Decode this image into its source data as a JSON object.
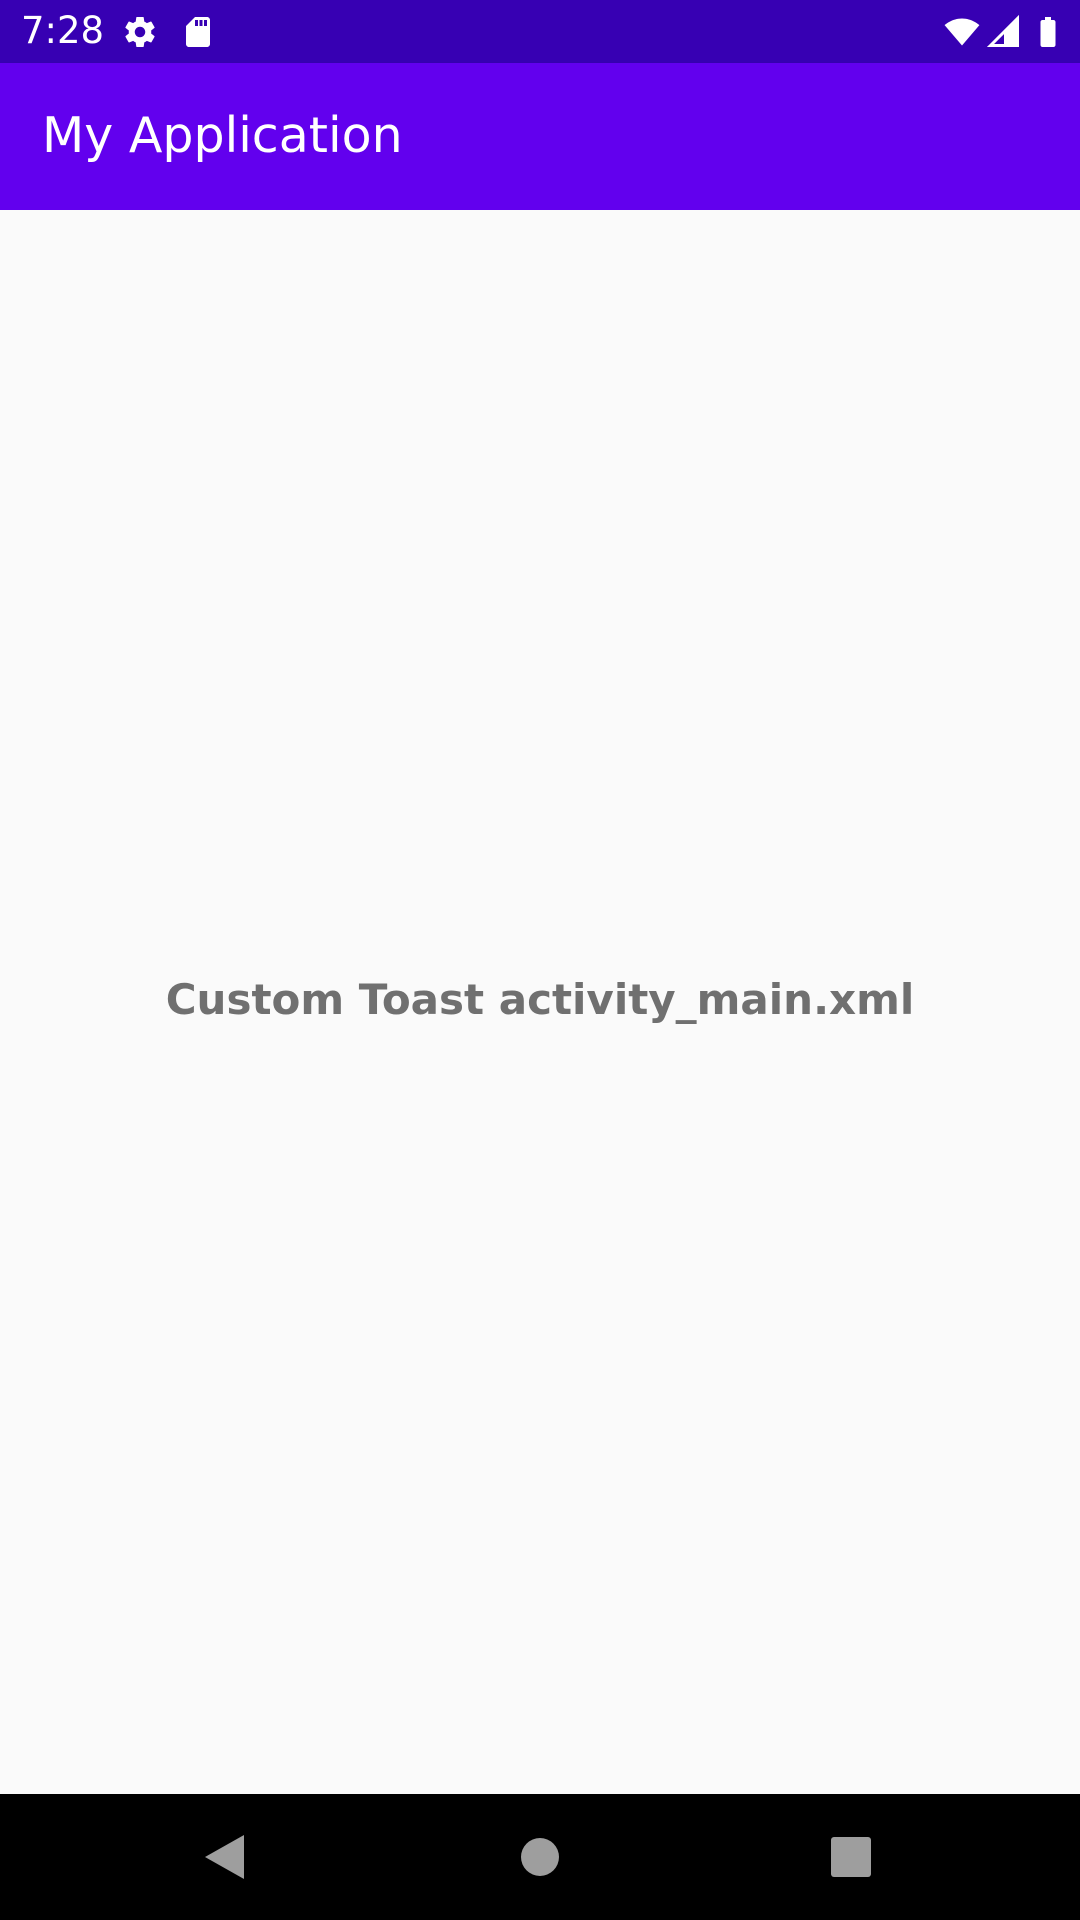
{
  "status_bar": {
    "time": "7:28",
    "icons": [
      "gear-icon",
      "sd-card-icon",
      "wifi-icon",
      "cellular-signal-icon",
      "battery-icon"
    ],
    "background": "#3700b3"
  },
  "app_bar": {
    "title": "My Application",
    "background": "#6200ee"
  },
  "main": {
    "message": "Custom Toast activity_main.xml",
    "text_color": "#707070"
  },
  "nav_bar": {
    "buttons": [
      "back-icon",
      "home-icon",
      "recents-icon"
    ]
  }
}
